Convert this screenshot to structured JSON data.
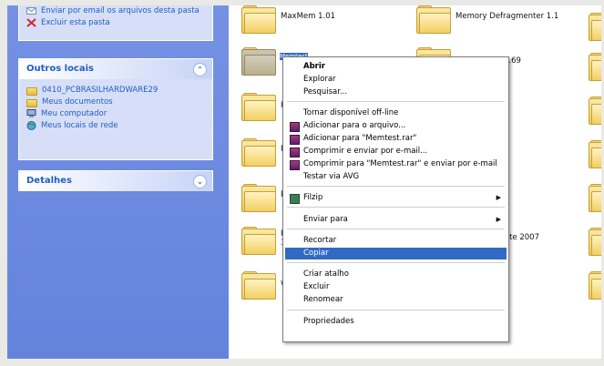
{
  "tasks": {
    "email_label": "Enviar por email os arquivos desta pasta",
    "delete_label": "Excluir esta pasta"
  },
  "other_places": {
    "header": "Outros locais",
    "items": [
      {
        "label": "0410_PCBRASILHARDWARE29"
      },
      {
        "label": "Meus documentos"
      },
      {
        "label": "Meu computador"
      },
      {
        "label": "Meus locais de rede"
      }
    ]
  },
  "details": {
    "header": "Detalhes"
  },
  "folders": [
    {
      "label": "MaxMem 1.01"
    },
    {
      "label": "Memory Defragmenter 1.1"
    },
    {
      "label": "Memtest"
    },
    {
      "label": "R"
    },
    {
      "label": "R"
    },
    {
      "label": "R"
    },
    {
      "label": "R"
    },
    {
      "label": "3"
    },
    {
      "label": "w"
    },
    {
      "label": "1.69"
    },
    {
      "label": "Lite 2007"
    }
  ],
  "context_menu": {
    "items": [
      {
        "label": "Abrir",
        "bold": true
      },
      {
        "label": "Explorar"
      },
      {
        "label": "Pesquisar..."
      },
      {
        "label": "Tornar disponível off-line"
      },
      {
        "label": "Adicionar para o arquivo..."
      },
      {
        "label": "Adicionar para \"Memtest.rar\""
      },
      {
        "label": "Comprimir e enviar por e-mail..."
      },
      {
        "label": "Comprimir para \"Memtest.rar\" e enviar por e-mail"
      },
      {
        "label": "Testar via  AVG"
      },
      {
        "label": "Filzip"
      },
      {
        "label": "Enviar para"
      },
      {
        "label": "Recortar"
      },
      {
        "label": "Copiar"
      },
      {
        "label": "Criar atalho"
      },
      {
        "label": "Excluir"
      },
      {
        "label": "Renomear"
      },
      {
        "label": "Propriedades"
      }
    ],
    "highlighted": "Copiar"
  },
  "colors": {
    "taskpane_bg": "#6483dc",
    "highlight": "#316ac5",
    "link": "#215dc6"
  }
}
